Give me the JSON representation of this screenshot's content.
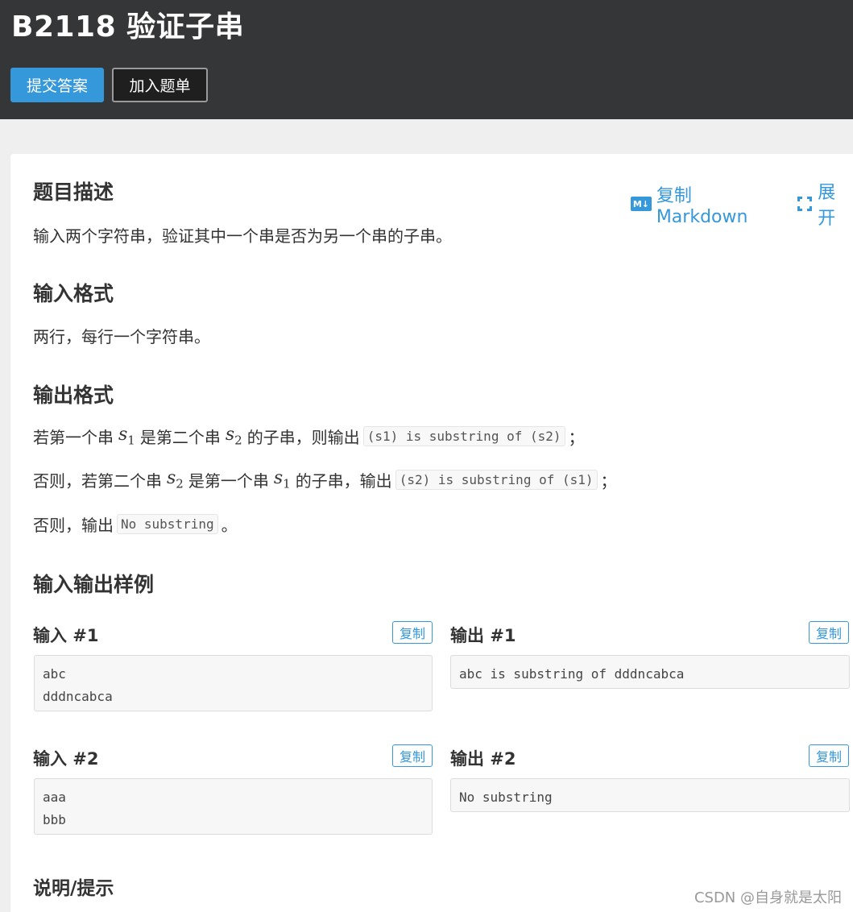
{
  "header": {
    "title": "B2118 验证子串",
    "submit_label": "提交答案",
    "add_list_label": "加入题单"
  },
  "toolbar": {
    "copy_markdown_label": "复制Markdown",
    "md_icon_text": "M↓",
    "expand_label": "展开"
  },
  "sections": {
    "description_title": "题目描述",
    "description_text": "输入两个字符串，验证其中一个串是否为另一个串的子串。",
    "input_format_title": "输入格式",
    "input_format_text": "两行，每行一个字符串。",
    "output_format_title": "输出格式",
    "output_lines": [
      {
        "pre": "若第一个串",
        "m1": "s",
        "m1sub": "1",
        "mid": "是第二个串",
        "m2": "s",
        "m2sub": "2",
        "post": "的子串，则输出",
        "code": "(s1) is substring of (s2)",
        "end": "；"
      },
      {
        "pre": "否则，若第二个串",
        "m1": "s",
        "m1sub": "2",
        "mid": "是第一个串",
        "m2": "s",
        "m2sub": "1",
        "post": "的子串，输出",
        "code": "(s2) is substring of (s1)",
        "end": "；"
      }
    ],
    "output_last_pre": "否则，输出",
    "output_last_code": "No substring",
    "output_last_end": "。",
    "samples_title": "输入输出样例",
    "hint_title": "说明/提示"
  },
  "samples": [
    {
      "input_label": "输入 #1",
      "output_label": "输出 #1",
      "input": "abc\ndddncabca",
      "output": "abc is substring of dddncabca"
    },
    {
      "input_label": "输入 #2",
      "output_label": "输出 #2",
      "input": "aaa\nbbb",
      "output": "No substring"
    }
  ],
  "copy_label": "复制",
  "watermark": "CSDN @自身就是太阳",
  "colors": {
    "accent": "#3498db",
    "header_bg": "#343638"
  }
}
